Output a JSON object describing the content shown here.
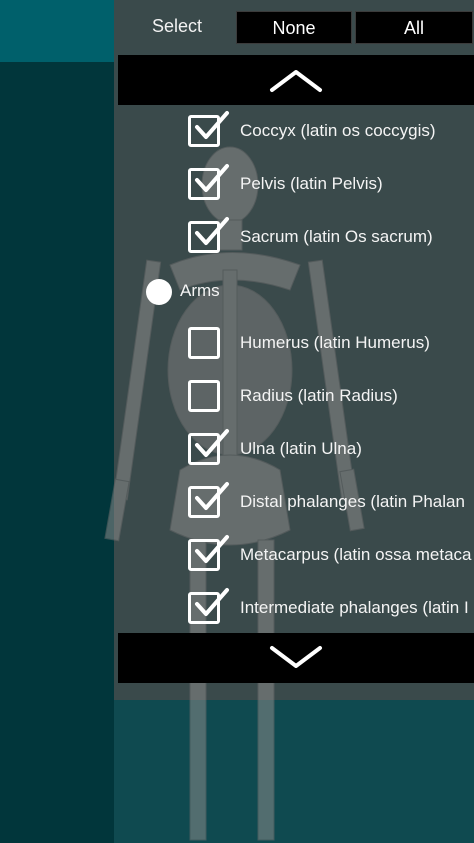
{
  "header": {
    "select_label": "Select",
    "none_label": "None",
    "all_label": "All"
  },
  "scroll": {
    "up_icon": "chevron-up-icon",
    "down_icon": "chevron-down-icon"
  },
  "list": {
    "items": [
      {
        "label": "Coccyx (latin os coccygis)",
        "checked": true
      },
      {
        "label": "Pelvis (latin Pelvis)",
        "checked": true
      },
      {
        "label": "Sacrum (latin Os sacrum)",
        "checked": true
      }
    ],
    "group": {
      "label": "Arms",
      "selected": true
    },
    "group_items": [
      {
        "label": "Humerus (latin Humerus)",
        "checked": false
      },
      {
        "label": "Radius (latin Radius)",
        "checked": false
      },
      {
        "label": "Ulna (latin Ulna)",
        "checked": true
      },
      {
        "label": "Distal phalanges (latin Phalan",
        "checked": true
      },
      {
        "label": "Metacarpus (latin ossa metaca",
        "checked": true
      },
      {
        "label": "Intermediate phalanges (latin I",
        "checked": true
      }
    ]
  },
  "colors": {
    "panel": "#3a4a4b",
    "teal_top": "#00606b",
    "dark_bg": "#013236"
  }
}
